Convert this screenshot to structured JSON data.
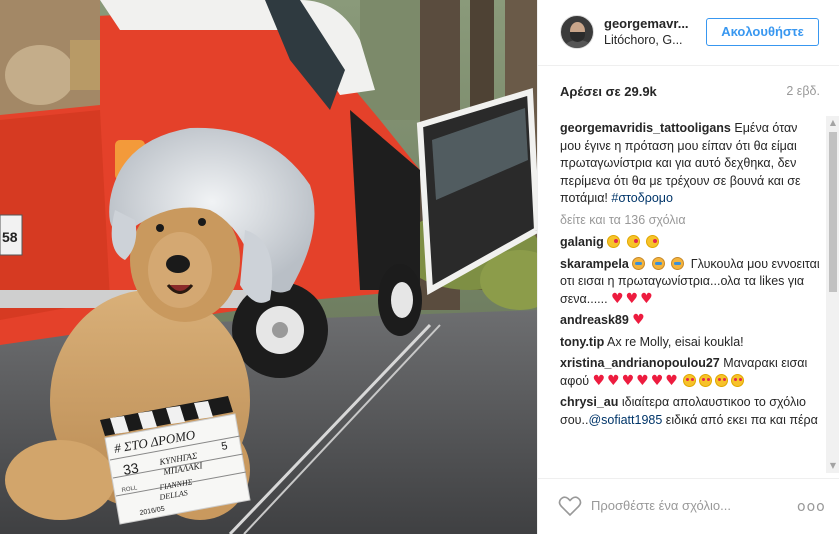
{
  "post": {
    "username": "georgemavr...",
    "location": "Litóchoro, G...",
    "follow_label": "Ακολουθήστε",
    "likes": "Αρέσει σε 29.9k",
    "time": "2 εβδ."
  },
  "caption": {
    "username": "georgemavridis_tattooligans",
    "text": "Εμένα όταν μου έγινε η πρόταση μου είπαν ότι θα είμαι πρωταγωνίστρια και για αυτό δεχθηκα, δεν περίμενα ότι θα με τρέχουν σε βουνά και σε ποτάμια!",
    "hashtag": "#στοδρομο"
  },
  "load_more": "δείτε και τα 136 σχόλια",
  "comments": [
    {
      "username": "galanig",
      "text": ""
    },
    {
      "username": "skarampela",
      "text": "Γλυκουλα μου εννοειται οτι εισαι η πρωταγωνίστρια...ολα τα likes για σενα......"
    },
    {
      "username": "andreask89",
      "text": ""
    },
    {
      "username": "tony.tip",
      "text": "Ax re Molly, eisai koukla!"
    },
    {
      "username": "xristina_andrianopoulou27",
      "text": "Μαναρακι εισαι αφού"
    },
    {
      "username": "chrysi_au",
      "text": "ιδιαίτερα απολαυστικοο το σχόλιο σου..",
      "mention": "@sofiatt1985",
      "text2": "ειδικά από εκει πα και πέρα"
    }
  ],
  "footer": {
    "add_comment_placeholder": "Προσθέστε ένα σχόλιο...",
    "more": "ooo"
  },
  "photo": {
    "clapper_lines": [
      "# ΣΤΟ ΔΡΟΜΟ",
      "SCENE",
      "TAKE",
      "33",
      "ΚΥΝΗΓΑΣ",
      "ΜΠΑΛΑΚΙ",
      "5",
      "ROLL",
      "DIR.",
      "ΓΙΑΝΝΗΣ",
      "DELLAS",
      "CAMERA",
      "DATE",
      "DAY/NIGHT",
      "INT/EXT",
      "2016/05"
    ],
    "plate": "58"
  },
  "colors": {
    "accent": "#3897f0",
    "heart": "#ed1c3f",
    "van": "#e4412a"
  }
}
